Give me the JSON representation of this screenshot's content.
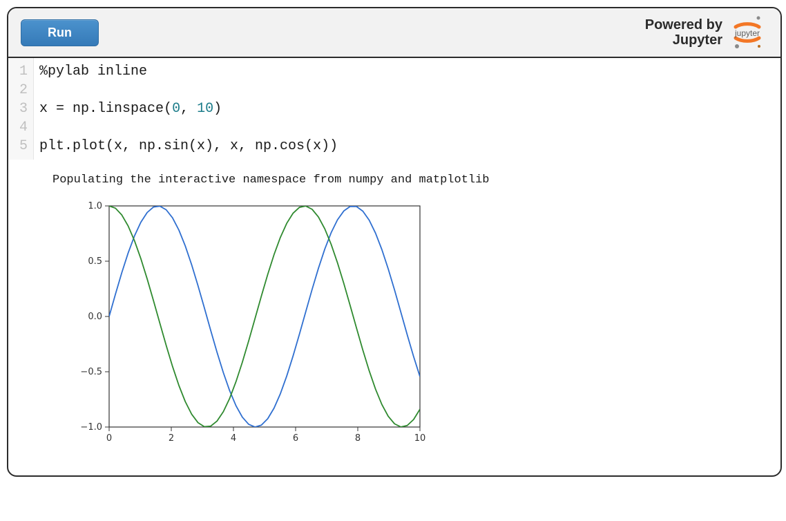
{
  "toolbar": {
    "run_label": "Run",
    "powered_by": "Powered by",
    "powered_name": "Jupyter"
  },
  "editor": {
    "line_numbers": [
      "1",
      "2",
      "3",
      "4",
      "5"
    ],
    "lines": [
      {
        "segments": [
          {
            "t": "%pylab inline",
            "cls": "tok-magic"
          }
        ]
      },
      {
        "segments": [
          {
            "t": "",
            "cls": ""
          }
        ]
      },
      {
        "segments": [
          {
            "t": "x ",
            "cls": ""
          },
          {
            "t": "=",
            "cls": "tok-kw"
          },
          {
            "t": " np.linspace(",
            "cls": "tok-func"
          },
          {
            "t": "0",
            "cls": "tok-num"
          },
          {
            "t": ", ",
            "cls": ""
          },
          {
            "t": "10",
            "cls": "tok-num"
          },
          {
            "t": ")",
            "cls": "tok-func"
          }
        ]
      },
      {
        "segments": [
          {
            "t": "",
            "cls": ""
          }
        ]
      },
      {
        "segments": [
          {
            "t": "plt.plot(x, np.sin(x), x, np.cos(x))",
            "cls": "tok-func"
          }
        ]
      }
    ]
  },
  "output": {
    "stdout": "Populating the interactive namespace from numpy and matplotlib"
  },
  "chart_data": {
    "type": "line",
    "x_start": 0,
    "x_end": 10,
    "n_points": 50,
    "series": [
      {
        "name": "sin(x)",
        "color": "#2f6fd0",
        "fn": "sin"
      },
      {
        "name": "cos(x)",
        "color": "#2f8a2f",
        "fn": "cos"
      }
    ],
    "xlim": [
      0,
      10
    ],
    "ylim": [
      -1.0,
      1.0
    ],
    "xticks": [
      0,
      2,
      4,
      6,
      8,
      10
    ],
    "yticks": [
      -1.0,
      -0.5,
      0.0,
      0.5,
      1.0
    ],
    "xtick_labels": [
      "0",
      "2",
      "4",
      "6",
      "8",
      "10"
    ],
    "ytick_labels": [
      "−1.0",
      "−0.5",
      "0.0",
      "0.5",
      "1.0"
    ]
  }
}
